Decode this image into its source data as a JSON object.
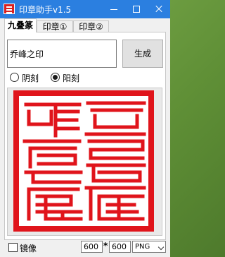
{
  "app": {
    "title": "印章助手v1.5"
  },
  "tabs": [
    {
      "label": "九叠篆",
      "active": true
    },
    {
      "label": "印章①",
      "active": false
    },
    {
      "label": "印章②",
      "active": false
    }
  ],
  "input": {
    "value": "乔峰之印"
  },
  "generate_button": {
    "label": "生成"
  },
  "carve_options": [
    {
      "label": "阴刻",
      "selected": false
    },
    {
      "label": "阳刻",
      "selected": true
    }
  ],
  "seal": {
    "color": "#e0141b"
  },
  "mirror": {
    "label": "镜像",
    "checked": false
  },
  "size": {
    "width": "600",
    "separator": "*",
    "height": "600"
  },
  "format": {
    "value": "PNG"
  },
  "colors": {
    "titlebar": "#2b7fe0",
    "seal_red": "#e0141b"
  }
}
